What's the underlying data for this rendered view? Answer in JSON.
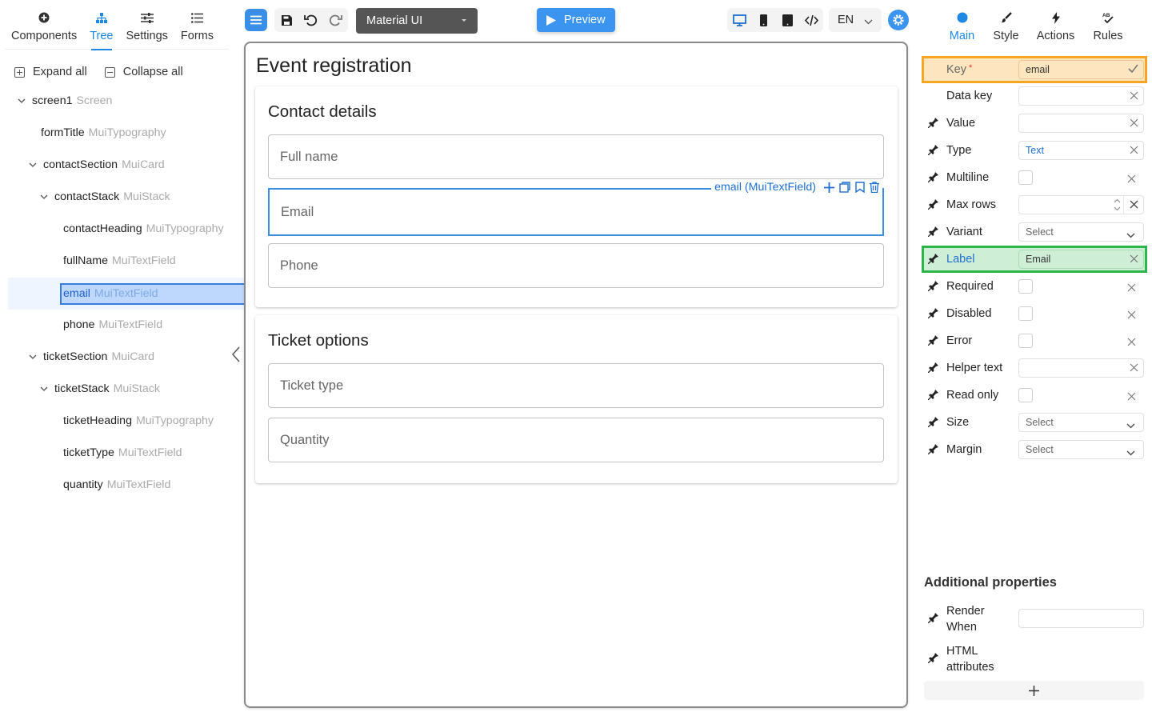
{
  "left_panel": {
    "tabs": [
      {
        "label": "Components",
        "icon": "plus-circle-icon"
      },
      {
        "label": "Tree",
        "icon": "sitemap-icon"
      },
      {
        "label": "Settings",
        "icon": "sliders-icon"
      },
      {
        "label": "Forms",
        "icon": "list-icon"
      }
    ],
    "active_tab": "Tree",
    "expand_all": "Expand all",
    "collapse_all": "Collapse all",
    "tree": [
      {
        "key": "screen1",
        "type": "Screen"
      },
      {
        "key": "formTitle",
        "type": "MuiTypography"
      },
      {
        "key": "contactSection",
        "type": "MuiCard"
      },
      {
        "key": "contactStack",
        "type": "MuiStack"
      },
      {
        "key": "contactHeading",
        "type": "MuiTypography"
      },
      {
        "key": "fullName",
        "type": "MuiTextField"
      },
      {
        "key": "email",
        "type": "MuiTextField"
      },
      {
        "key": "phone",
        "type": "MuiTextField"
      },
      {
        "key": "ticketSection",
        "type": "MuiCard"
      },
      {
        "key": "ticketStack",
        "type": "MuiStack"
      },
      {
        "key": "ticketHeading",
        "type": "MuiTypography"
      },
      {
        "key": "ticketType",
        "type": "MuiTextField"
      },
      {
        "key": "quantity",
        "type": "MuiTextField"
      }
    ],
    "selected": "email"
  },
  "toolbar": {
    "theme": "Material UI",
    "preview": "Preview",
    "language": "EN",
    "accent": "#3a94f0"
  },
  "canvas": {
    "form_title": "Event registration",
    "contact_heading": "Contact details",
    "fields_contact": [
      "Full name",
      "Email",
      "Phone"
    ],
    "active_field_tag": "email (MuiTextField)",
    "ticket_heading": "Ticket options",
    "fields_ticket": [
      "Ticket type",
      "Quantity"
    ]
  },
  "right_panel": {
    "tabs": [
      {
        "label": "Main",
        "icon": "dot-icon"
      },
      {
        "label": "Style",
        "icon": "brush-icon"
      },
      {
        "label": "Actions",
        "icon": "bolt-icon"
      },
      {
        "label": "Rules",
        "icon": "rules-icon"
      }
    ],
    "active_tab": "Main",
    "props": {
      "key": {
        "label": "Key",
        "value": "email"
      },
      "data_key": {
        "label": "Data key",
        "value": ""
      },
      "value": {
        "label": "Value",
        "value": ""
      },
      "type": {
        "label": "Type",
        "value": "Text"
      },
      "multiline": {
        "label": "Multiline"
      },
      "max_rows": {
        "label": "Max rows",
        "value": ""
      },
      "variant": {
        "label": "Variant",
        "value": "Select"
      },
      "label": {
        "label": "Label",
        "value": "Email"
      },
      "required": {
        "label": "Required"
      },
      "disabled": {
        "label": "Disabled"
      },
      "error": {
        "label": "Error"
      },
      "helper_text": {
        "label": "Helper text",
        "value": ""
      },
      "read_only": {
        "label": "Read only"
      },
      "size": {
        "label": "Size",
        "value": "Select"
      },
      "margin": {
        "label": "Margin",
        "value": "Select"
      }
    },
    "additional_title": "Additional properties",
    "render_when": "Render When",
    "html_attributes": "HTML attributes"
  }
}
